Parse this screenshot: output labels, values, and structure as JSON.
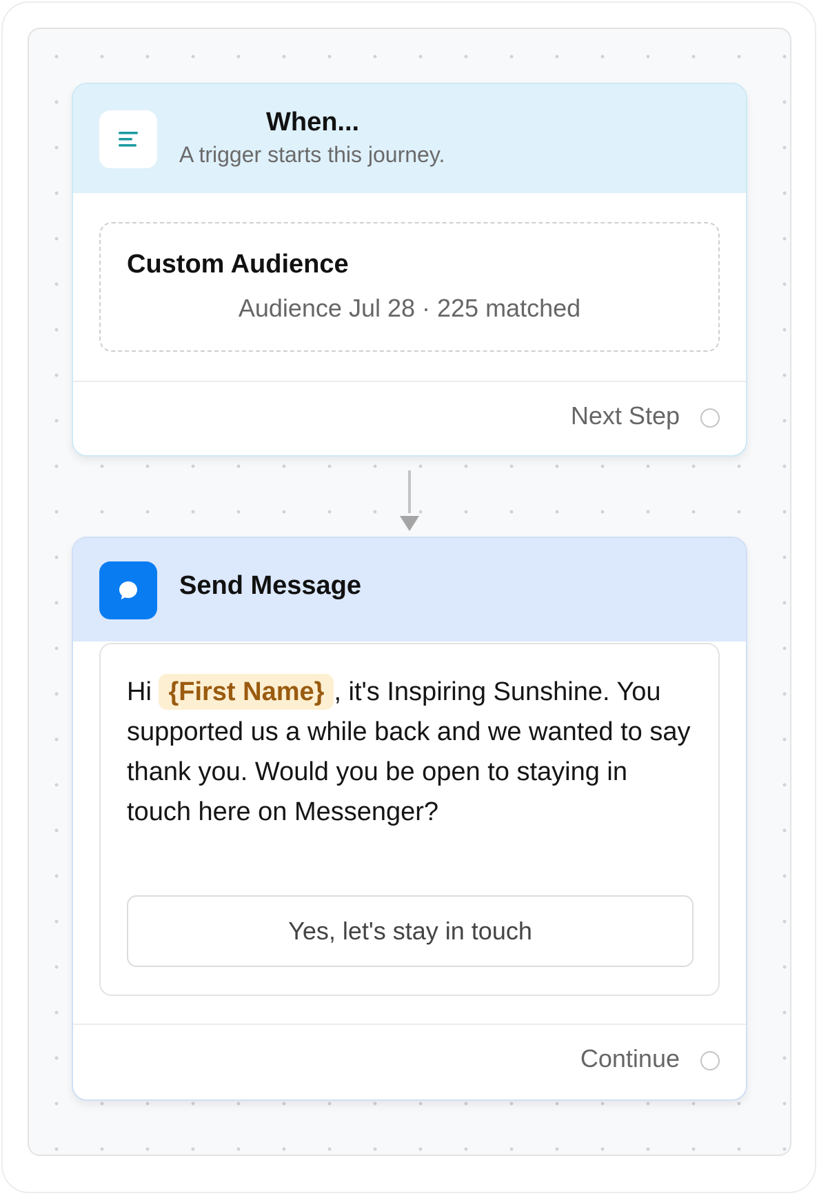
{
  "trigger": {
    "title": "When...",
    "subtitle": "A trigger starts this journey.",
    "icon": "lines-icon",
    "icon_color": "#1a9aa0",
    "audience": {
      "title": "Custom Audience",
      "meta": "Audience Jul 28 · 225 matched"
    },
    "footer_label": "Next Step"
  },
  "message": {
    "title": "Send Message",
    "icon": "chat-bubble-icon",
    "icon_bg": "#0a7cf2",
    "greeting": "Hi",
    "token": "{First Name}",
    "text_after_token": ", it's Inspiring Sunshine. You supported us a while back and we wanted to say thank you. Would you be open to staying in touch here on Messenger?",
    "quick_reply": "Yes, let's stay in touch",
    "footer_label": "Continue"
  }
}
